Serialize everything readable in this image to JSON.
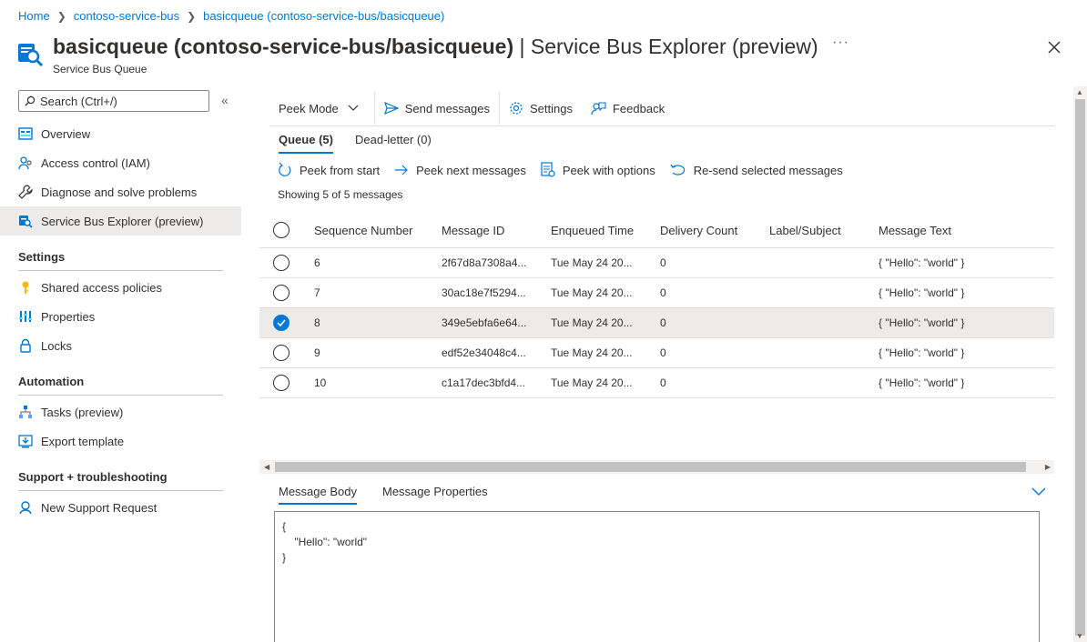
{
  "breadcrumb": [
    "Home",
    "contoso-service-bus",
    "basicqueue (contoso-service-bus/basicqueue)"
  ],
  "header": {
    "title_bold": "basicqueue (contoso-service-bus/basicqueue)",
    "title_rest": " | Service Bus Explorer (preview)",
    "subtitle": "Service Bus Queue",
    "more": "···"
  },
  "sidebar": {
    "search_placeholder": "Search (Ctrl+/)",
    "collapse": "«",
    "items": [
      {
        "label": "Overview",
        "icon": "overview-icon"
      },
      {
        "label": "Access control (IAM)",
        "icon": "people-icon"
      },
      {
        "label": "Diagnose and solve problems",
        "icon": "wrench-icon"
      },
      {
        "label": "Service Bus Explorer (preview)",
        "icon": "explorer-icon",
        "selected": true
      }
    ],
    "sections": [
      {
        "title": "Settings",
        "items": [
          {
            "label": "Shared access policies",
            "icon": "key-icon"
          },
          {
            "label": "Properties",
            "icon": "properties-icon"
          },
          {
            "label": "Locks",
            "icon": "lock-icon"
          }
        ]
      },
      {
        "title": "Automation",
        "items": [
          {
            "label": "Tasks (preview)",
            "icon": "tasks-icon"
          },
          {
            "label": "Export template",
            "icon": "export-icon"
          }
        ]
      },
      {
        "title": "Support + troubleshooting",
        "items": [
          {
            "label": "New Support Request",
            "icon": "support-icon"
          }
        ]
      }
    ]
  },
  "toolbar": {
    "mode": "Peek Mode",
    "send": "Send messages",
    "settings": "Settings",
    "feedback": "Feedback"
  },
  "tabs": [
    "Queue (5)",
    "Dead-letter (0)"
  ],
  "actions": {
    "peek_start": "Peek from start",
    "peek_next": "Peek next messages",
    "peek_options": "Peek with options",
    "resend": "Re-send selected messages"
  },
  "showing": "Showing 5 of 5 messages",
  "table": {
    "columns": [
      "Sequence Number",
      "Message ID",
      "Enqueued Time",
      "Delivery Count",
      "Label/Subject",
      "Message Text"
    ],
    "rows": [
      {
        "seq": "6",
        "id": "2f67d8a7308a4...",
        "time": "Tue May 24 20...",
        "count": "0",
        "label": "",
        "text": "{ \"Hello\": \"world\" }",
        "selected": false
      },
      {
        "seq": "7",
        "id": "30ac18e7f5294...",
        "time": "Tue May 24 20...",
        "count": "0",
        "label": "",
        "text": "{ \"Hello\": \"world\" }",
        "selected": false
      },
      {
        "seq": "8",
        "id": "349e5ebfa6e64...",
        "time": "Tue May 24 20...",
        "count": "0",
        "label": "",
        "text": "{ \"Hello\": \"world\" }",
        "selected": true
      },
      {
        "seq": "9",
        "id": "edf52e34048c4...",
        "time": "Tue May 24 20...",
        "count": "0",
        "label": "",
        "text": "{ \"Hello\": \"world\" }",
        "selected": false
      },
      {
        "seq": "10",
        "id": "c1a17dec3bfd4...",
        "time": "Tue May 24 20...",
        "count": "0",
        "label": "",
        "text": "{ \"Hello\": \"world\" }",
        "selected": false
      }
    ]
  },
  "bottom_tabs": [
    "Message Body",
    "Message Properties"
  ],
  "message_body": "{\n    \"Hello\": \"world\"\n}",
  "colors": {
    "accent": "#0078d4",
    "selected_row": "#edebe9"
  }
}
